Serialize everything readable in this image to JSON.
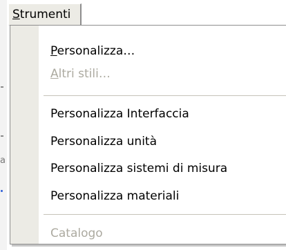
{
  "menu": {
    "title_mnemonic": "S",
    "title_rest": "trumenti",
    "items": [
      {
        "mnemonic": "P",
        "rest": "ersonalizza…",
        "enabled": true
      },
      {
        "mnemonic": "A",
        "rest": "ltri stili…",
        "enabled": false
      },
      {
        "label": "Personalizza Interfaccia",
        "enabled": true
      },
      {
        "label": "Personalizza unità",
        "enabled": true
      },
      {
        "label": "Personalizza sistemi di misura",
        "enabled": true
      },
      {
        "label": "Personalizza materiali",
        "enabled": true
      },
      {
        "label": "Catalogo",
        "enabled": false
      }
    ]
  },
  "colors": {
    "menu_background": "#ffffff",
    "gutter": "#ecebe5",
    "disabled_text": "#acaaa0",
    "border": "#8d8d8d"
  }
}
